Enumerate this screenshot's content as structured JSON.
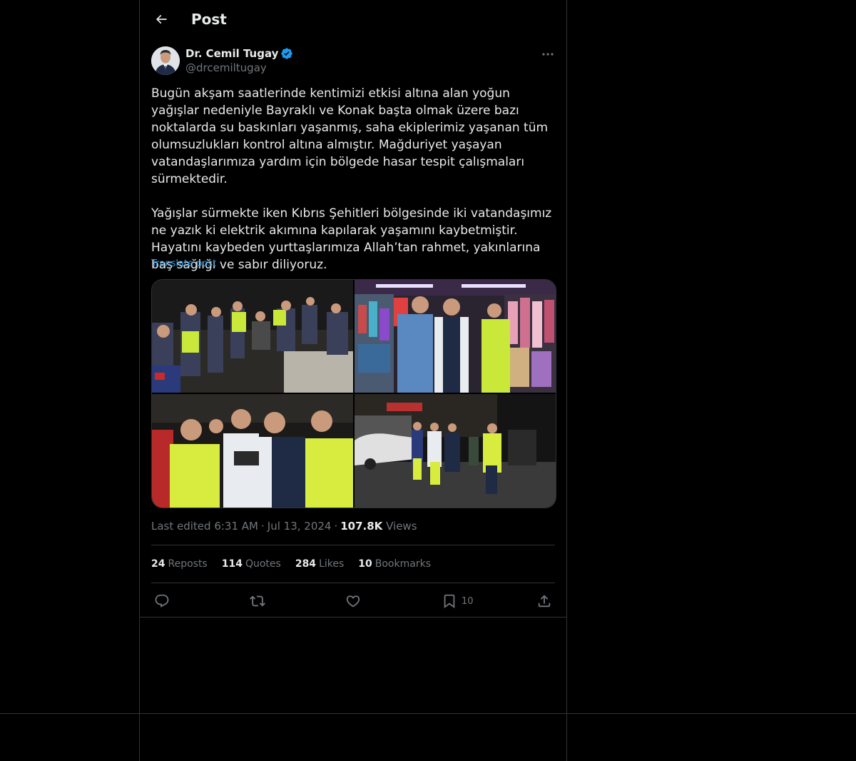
{
  "header": {
    "title": "Post",
    "back_icon": "arrow-left-icon"
  },
  "author": {
    "display_name": "Dr. Cemil Tugay",
    "handle": "@drcemiltugay",
    "verified_icon": "verified-badge-icon",
    "verified_color": "#1d9bf0"
  },
  "post": {
    "text": "Bugün akşam saatlerinde kentimizi etkisi altına alan yoğun yağışlar nedeniyle Bayraklı ve Konak başta olmak üzere bazı noktalarda su baskınları yaşanmış, saha ekiplerimiz yaşanan tüm olumsuzlukları kontrol altına almıştır. Mağduriyet yaşayan vatandaşlarımıza yardım için bölgede hasar tespit çalışmaları sürmektedir.\n\nYağışlar sürmekte iken Kıbrıs Şehitleri bölgesinde iki vatandaşımız ne yazık ki elektrik akımına kapılarak yaşamını kaybetmiştir. Hayatını kaybeden yurttaşlarımıza Allah’tan rahmet, yakınlarına baş sağlığı ve sabır diliyoruz.",
    "translate_label": "Translate post",
    "media_count": 4,
    "meta": {
      "edited_label": "Last edited 6:31 AM",
      "separator": "·",
      "date": "Jul 13, 2024",
      "views_count": "107.8K",
      "views_label": "Views"
    }
  },
  "stats": [
    {
      "count": "24",
      "label": "Reposts"
    },
    {
      "count": "114",
      "label": "Quotes"
    },
    {
      "count": "284",
      "label": "Likes"
    },
    {
      "count": "10",
      "label": "Bookmarks"
    }
  ],
  "actions": {
    "reply_icon": "reply-icon",
    "repost_icon": "repost-icon",
    "like_icon": "heart-icon",
    "bookmark_icon": "bookmark-icon",
    "bookmark_count": "10",
    "share_icon": "share-icon"
  },
  "colors": {
    "background": "#000000",
    "text_primary": "#e7e9ea",
    "text_secondary": "#71767b",
    "accent": "#1d9bf0",
    "border": "#2f3336"
  }
}
